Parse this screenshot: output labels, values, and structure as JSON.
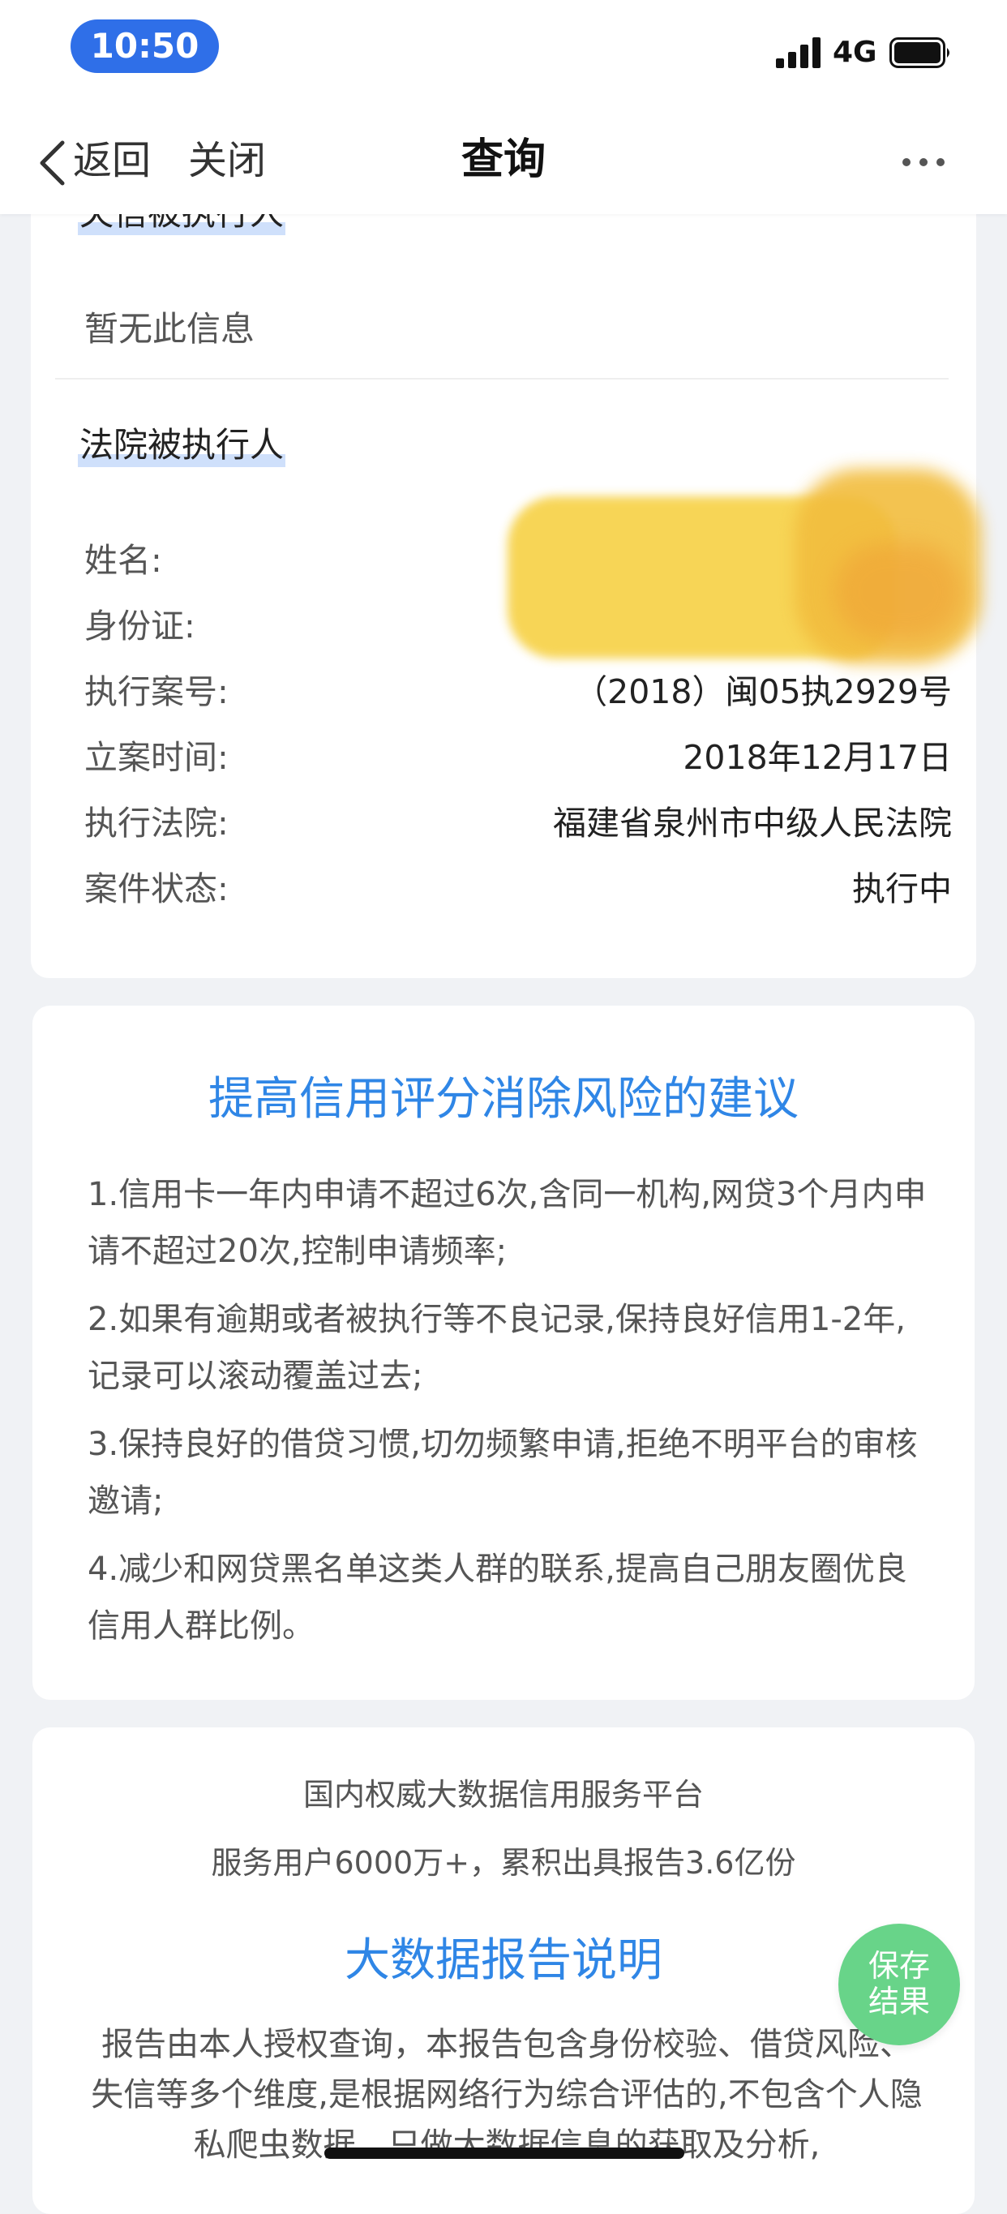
{
  "status_bar": {
    "time": "10:50",
    "network": "4G",
    "icons": [
      "signal-icon",
      "battery-icon"
    ]
  },
  "nav": {
    "back_label": "返回",
    "close_label": "关闭",
    "title": "查询",
    "icons": [
      "chevron-left-icon",
      "more-icon"
    ]
  },
  "dishonest_section": {
    "label": "失信被执行人",
    "empty_text": "暂无此信息"
  },
  "court_section": {
    "label": "法院被执行人",
    "rows": [
      {
        "key": "姓名:",
        "value": ""
      },
      {
        "key": "身份证:",
        "value": ""
      },
      {
        "key": "执行案号:",
        "value": "（2018）闽05执2929号"
      },
      {
        "key": "立案时间:",
        "value": "2018年12月17日"
      },
      {
        "key": "执行法院:",
        "value": "福建省泉州市中级人民法院"
      },
      {
        "key": "案件状态:",
        "value": "执行中"
      }
    ],
    "redaction_colors": [
      "#f7d34d",
      "#f2bd3e",
      "#f0a638"
    ]
  },
  "advice": {
    "title": "提高信用评分消除风险的建议",
    "items": [
      "1.信用卡一年内申请不超过6次,含同一机构,网贷3个月内申请不超过20次,控制申请频率;",
      "2.如果有逾期或者被执行等不良记录,保持良好信用1-2年,记录可以滚动覆盖过去;",
      "3.保持良好的借贷习惯,切勿频繁申请,拒绝不明平台的审核邀请;",
      "4.减少和网贷黑名单这类人群的联系,提高自己朋友圈优良信用人群比例。"
    ]
  },
  "platform": {
    "subtitle": "国内权威大数据信用服务平台",
    "stats": "服务用户6000万+，累积出具报告3.6亿份",
    "report_title": "大数据报告说明",
    "description": "报告由本人授权查询，本报告包含身份校验、借贷风险、失信等多个维度,是根据网络行为综合评估的,不包含个人隐私爬虫数据。只做大数据信息的获取及分析,"
  },
  "save_button": {
    "line1": "保存",
    "line2": "结果"
  },
  "colors": {
    "accent": "#2f86e6",
    "time_pill": "#2f6fe8",
    "save_button": "#68d489",
    "label_highlight": "#cfe0fb",
    "background": "#f0f2f5"
  }
}
